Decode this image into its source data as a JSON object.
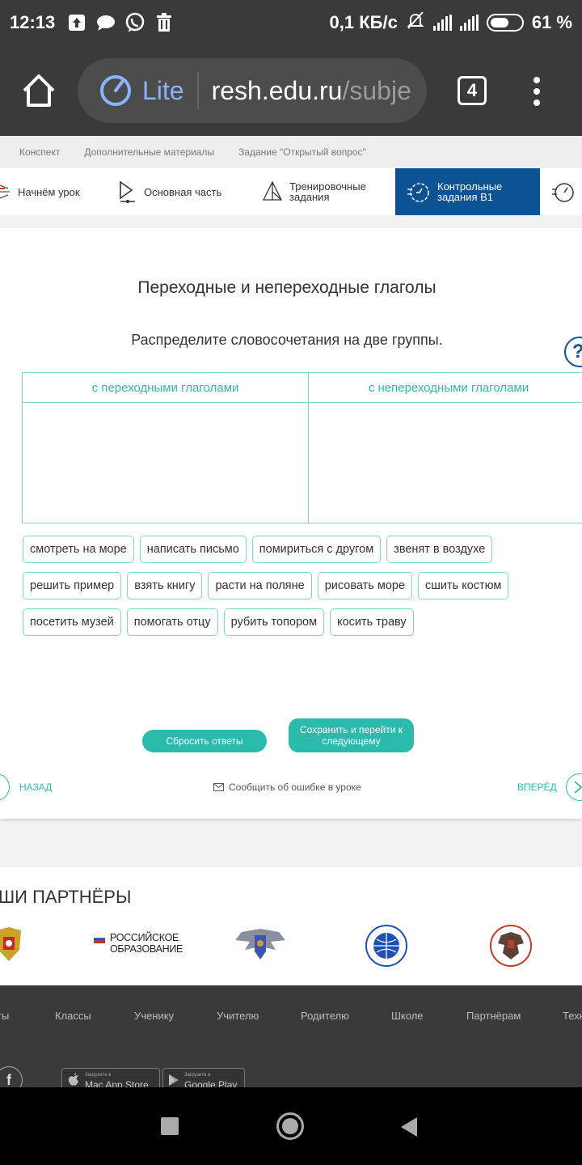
{
  "status": {
    "time": "12:13",
    "speed": "0,1 КБ/с",
    "battery": "61 %",
    "battery_level": 0.61
  },
  "browser": {
    "lite": "Lite",
    "url_host": "resh.edu.ru",
    "url_path": "/subje",
    "tabs_count": "4"
  },
  "subnav": [
    "Конспект",
    "Дополнительные материалы",
    "Задание \"Открытый вопрос\""
  ],
  "lesson_nav": {
    "start": "Начнём урок",
    "main": "Основная часть",
    "training_1": "Тренировочные",
    "training_2": "задания",
    "control_1": "Контрольные",
    "control_2": "задания В1"
  },
  "task": {
    "title": "Переходные и непереходные глаголы",
    "instruction": "Распределите словосочетания на две группы.",
    "help": "?",
    "group_1": "с переходными глаголами",
    "group_2": "с непереходными глаголами",
    "chips": [
      [
        "смотреть на море",
        "написать письмо",
        "помириться с другом",
        "звенят в воздухе"
      ],
      [
        "решить пример",
        "взять книгу",
        "расти на поляне",
        "рисовать море",
        "сшить костюм"
      ],
      [
        "посетить музей",
        "помогать отцу",
        "рубить топором",
        "косить траву"
      ]
    ],
    "reset": "Сбросить ответы",
    "save": "Сохранить и перейти к следующему"
  },
  "pager": {
    "back": "НАЗАД",
    "report": "Сообщить об ошибке в уроке",
    "forward": "ВПЕРЁД"
  },
  "partners": {
    "title": "ШИ ПАРТНЁРЫ",
    "ro_line1": "РОССИЙСКОЕ",
    "ro_line2": "ОБРАЗОВАНИЕ"
  },
  "footer": {
    "links": [
      "ты",
      "Классы",
      "Ученику",
      "Учителю",
      "Родителю",
      "Школе",
      "Партнёрам",
      "Техн"
    ],
    "fb": "f",
    "appstore_small": "Загрузите в",
    "appstore": "Mac App Store",
    "gplay_small": "Загрузите в",
    "gplay": "Google Play"
  },
  "colors": {
    "accent": "#2bbbad",
    "active_tab": "#0b5394",
    "chrome": "#3a3a3a",
    "url_lite": "#8ab4f8"
  }
}
